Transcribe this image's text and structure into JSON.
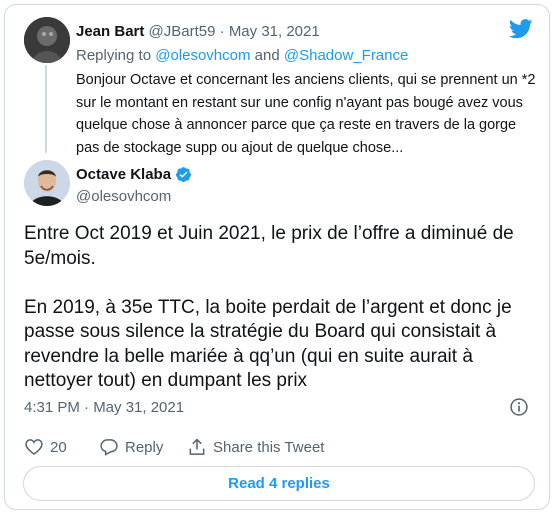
{
  "parent_tweet": {
    "name": "Jean Bart",
    "handle": "@JBart59",
    "separator": "·",
    "date": "May 31, 2021",
    "replying_prefix": "Replying to",
    "replying_to_1": "@olesovhcom",
    "replying_and": "and",
    "replying_to_2": "@Shadow_France",
    "text": "Bonjour Octave et concernant les anciens clients, qui se prennent un *2 sur le montant en restant sur une config n'ayant pas bougé avez vous quelque chose à annoncer parce que ça reste en travers de la gorge pas de stockage supp ou ajout de quelque chose..."
  },
  "main_tweet": {
    "name": "Octave Klaba",
    "handle": "@olesovhcom",
    "paragraph_1": "Entre Oct 2019 et Juin 2021, le prix de l’offre a diminué de 5e/mois.",
    "paragraph_2": "En 2019, à 35e TTC, la boite perdait de l’argent et donc je passe sous silence la stratégie du Board qui consistait à revendre la belle mariée à qq’un (qui en suite aurait à nettoyer tout) en dumpant les prix",
    "timestamp": "4:31 PM · May 31, 2021"
  },
  "actions": {
    "like_count": "20",
    "reply_label": "Reply",
    "share_label": "Share this Tweet"
  },
  "read_replies_label": "Read 4 replies",
  "colors": {
    "accent": "#1d9bf0",
    "text_primary": "#0f1419",
    "text_secondary": "#536471",
    "border": "#cfd9de"
  },
  "icons": {
    "brand": "twitter-bird-icon",
    "verified": "verified-badge-icon",
    "info": "info-icon",
    "like": "heart-icon",
    "reply": "reply-bubble-icon",
    "share": "share-icon"
  }
}
